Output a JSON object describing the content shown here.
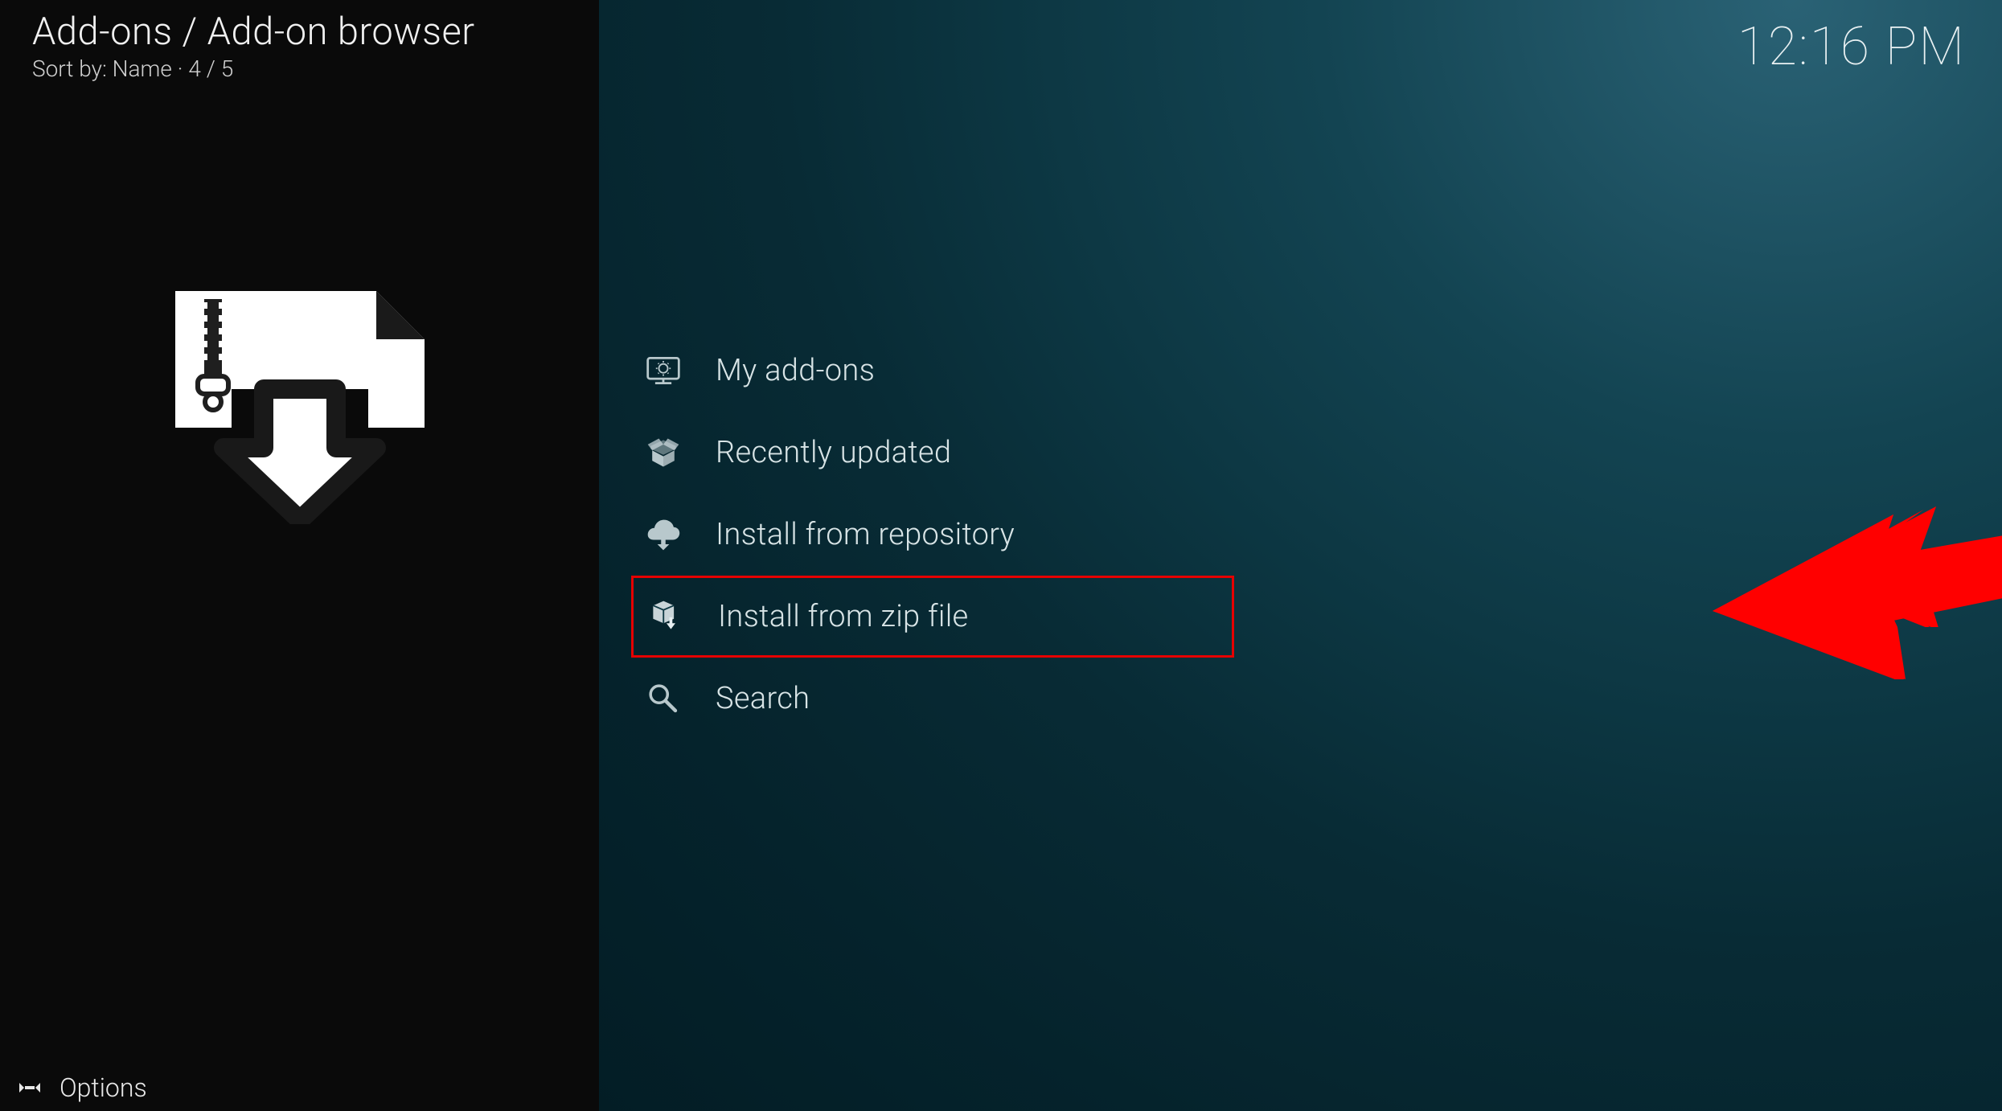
{
  "header": {
    "breadcrumb": "Add-ons / Add-on browser",
    "sort_prefix": "Sort by: ",
    "sort_value": "Name",
    "sort_sep": "  ·  ",
    "count": "4 / 5",
    "clock": "12:16 PM"
  },
  "menu": {
    "items": [
      {
        "label": "My add-ons",
        "icon": "monitor-addons-icon"
      },
      {
        "label": "Recently updated",
        "icon": "open-box-icon"
      },
      {
        "label": "Install from repository",
        "icon": "cloud-download-icon"
      },
      {
        "label": "Install from zip file",
        "icon": "box-zip-icon",
        "highlighted": true
      },
      {
        "label": "Search",
        "icon": "search-icon"
      }
    ]
  },
  "footer": {
    "options_label": "Options"
  },
  "colors": {
    "annotation_red": "#ff0000"
  }
}
